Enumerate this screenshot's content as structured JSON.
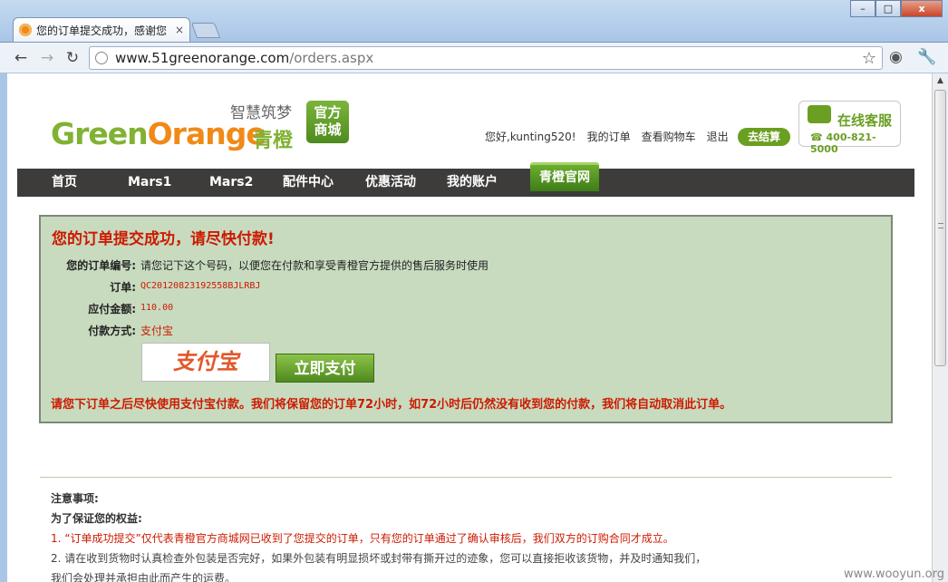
{
  "browser": {
    "tab_title": "您的订单提交成功，感谢您",
    "tab_close": "×",
    "url_host": "www.51greenorange.com",
    "url_path": "/orders.aspx",
    "win_minimize": "–",
    "win_maximize": "□",
    "win_close": "x"
  },
  "header": {
    "logo_green": "Green",
    "logo_orange": "Orange",
    "logo_cn": "青橙",
    "slogan": "智慧筑梦",
    "mall_badge_line1": "官方",
    "mall_badge_line2": "商城",
    "greeting": "您好,kunting520!",
    "my_orders": "我的订单",
    "view_cart": "查看购物车",
    "logout": "退出",
    "checkout": "去结算",
    "service_title": "在线客服",
    "service_phone": "400-821-5000"
  },
  "nav": {
    "items": [
      "首页",
      "Mars1",
      "Mars2",
      "配件中心",
      "优惠活动",
      "我的账户"
    ],
    "official": "青橙官网"
  },
  "order": {
    "title": "您的订单提交成功，请尽快付款!",
    "number_label": "您的订单编号:",
    "number_hint": "请您记下这个号码，以便您在付款和享受青橙官方提供的售后服务时使用",
    "order_label": "订单:",
    "order_id": "QC20120823192558BJLRBJ",
    "amount_label": "应付金额:",
    "amount": "110.00",
    "method_label": "付款方式:",
    "method": "支付宝",
    "alipay_logo": "支付宝",
    "pay_now": "立即支付",
    "warning": "请您下订单之后尽快使用支付宝付款。我们将保留您的订单72小时，如72小时后仍然没有收到您的付款，我们将自动取消此订单。"
  },
  "notes": {
    "title": "注意事项:",
    "subtitle": "为了保证您的权益:",
    "item1": "1. “订单成功提交”仅代表青橙官方商城网已收到了您提交的订单，只有您的订单通过了确认审核后，我们双方的订购合同才成立。",
    "item2": "2. 请在收到货物时认真检查外包装是否完好，如果外包装有明显损坏或封带有撕开过的迹象，您可以直接拒收该货物，并及时通知我们，",
    "item3": "我们会处理并承担由此而产生的运费。"
  },
  "watermark": "www.wooyun.org",
  "colors": {
    "brand_green": "#80b234",
    "brand_orange": "#f08a17",
    "panel_bg": "#c8dbbf",
    "alert_red": "#cc1a00",
    "nav_bg": "#3e3c3b"
  }
}
